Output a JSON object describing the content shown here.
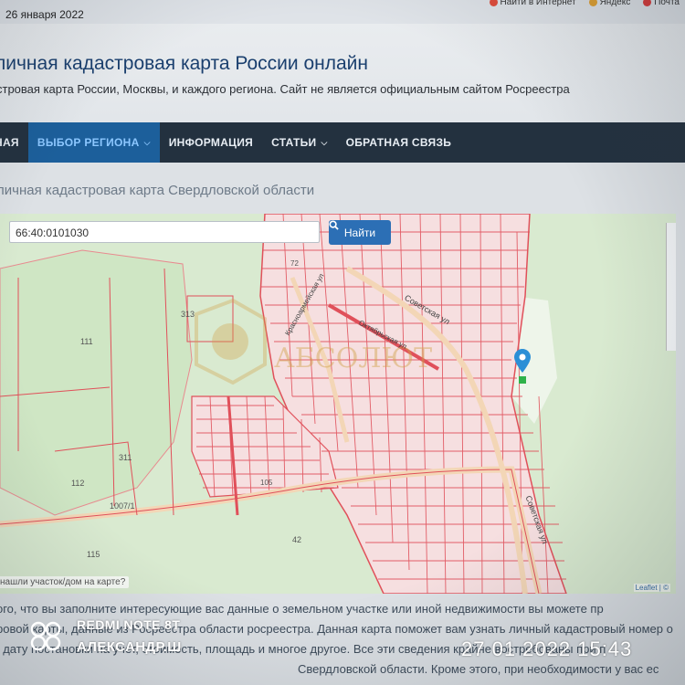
{
  "topbar": {
    "date": "26 января 2022",
    "links": [
      "Найти в Интернет",
      "Яндекс",
      "Почта"
    ]
  },
  "header": {
    "title": "личная кадастровая карта России онлайн",
    "subtitle": "стровая карта России, Москвы, и каждого региона. Сайт не является официальным сайтом Росреестра"
  },
  "nav": {
    "items": [
      {
        "label": "НАЯ",
        "active": false,
        "caret": false
      },
      {
        "label": "ВЫБОР РЕГИОНА",
        "active": true,
        "caret": true
      },
      {
        "label": "ИНФОРМАЦИЯ",
        "active": false,
        "caret": false
      },
      {
        "label": "СТАТЬИ",
        "active": false,
        "caret": true
      },
      {
        "label": "ОБРАТНАЯ СВЯЗЬ",
        "active": false,
        "caret": false
      }
    ]
  },
  "page": {
    "title": "личная кадастровая карта Свердловской области"
  },
  "map": {
    "search_value": "66:40:0101030",
    "find_label": "Найти",
    "hint": "нашли участок/дом на карте?",
    "attribution": "Leaflet | ©",
    "labels": [
      "111",
      "313",
      "311",
      "112",
      "1007/1",
      "115",
      "42",
      "72",
      "Советская ул",
      "Советская ул",
      "Октябрьская ул",
      "Красноармейская ул",
      "105"
    ],
    "watermark": "АБСОЛЮТ",
    "colors": {
      "parcel_line": "#e0505a",
      "map_bg": "#d9ead0",
      "road": "#f3d6b6",
      "marker": "#2b8fd6"
    }
  },
  "body_text": [
    "ого, что вы заполните интересующие вас данные о земельном участке или иной недвижимости вы можете пр",
    "ровой карты, данные из Росреестра области росреестра. Данная карта поможет вам узнать личный кадастровый номер о",
    ", дату постановки на учет, стоимость, площадь и многое другое. Все эти сведения крайне востребованы при п",
    "Свердловской области. Кроме этого, при необходимости у вас ес"
  ],
  "photo_overlay": {
    "device": "REDMI NOTE 8T",
    "owner": "АЛЕКСАНДР.Ш",
    "timestamp": "27 01 2022 15:43"
  }
}
